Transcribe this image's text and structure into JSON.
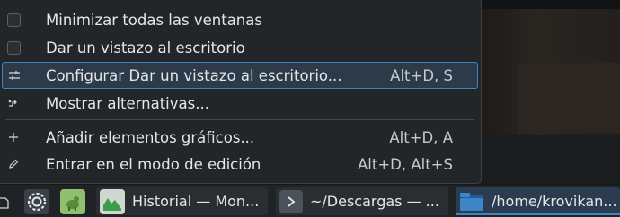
{
  "menu": {
    "items": [
      {
        "label": "Minimizar todas las ventanas",
        "shortcut": "",
        "icon": "checkbox-icon"
      },
      {
        "label": "Dar un vistazo al escritorio",
        "shortcut": "",
        "icon": "checkbox-icon"
      },
      {
        "label": "Configurar Dar un vistazo al escritorio...",
        "shortcut": "Alt+D, S",
        "icon": "configure-icon",
        "highlighted": true
      },
      {
        "label": "Mostrar alternativas...",
        "shortcut": "",
        "icon": "alternatives-icon"
      },
      {
        "label": "Añadir elementos gráficos...",
        "shortcut": "Alt+D, A",
        "icon": "add-icon"
      },
      {
        "label": "Entrar en el modo de edición",
        "shortcut": "Alt+D, Alt+S",
        "icon": "edit-icon"
      }
    ]
  },
  "taskbar": {
    "tasks": [
      {
        "label": "Historial — Mon...",
        "icon": "system-monitor-icon"
      },
      {
        "label": "~/Descargas — ...",
        "icon": "terminal-icon"
      },
      {
        "label": "/home/krovikan...",
        "icon": "folder-icon",
        "active": true
      }
    ]
  },
  "colors": {
    "menu_bg": "#232629",
    "highlight_border": "#3d86c6",
    "highlight_bg": "#2c3a4a",
    "taskbar_bg": "#202326"
  }
}
